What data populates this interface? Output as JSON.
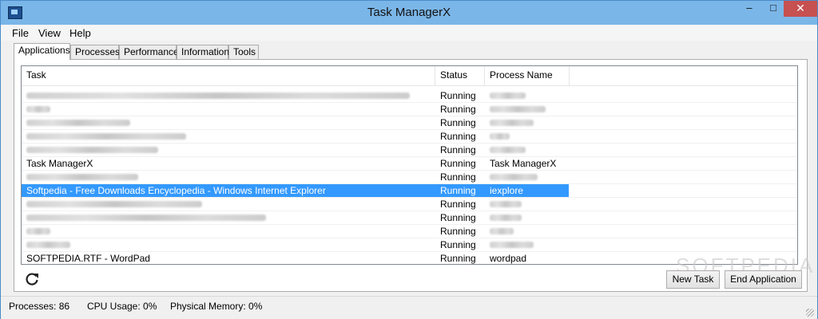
{
  "window": {
    "title": "Task ManagerX",
    "minimize": "–",
    "maximize": "□",
    "close": "✕"
  },
  "menu": [
    "File",
    "View",
    "Help"
  ],
  "tabs": [
    "Applications",
    "Processes",
    "Performance",
    "Information",
    "Tools"
  ],
  "active_tab": "Applications",
  "table": {
    "columns": [
      "Task",
      "Status",
      "Process Name"
    ],
    "rows": [
      {
        "task": "",
        "status": "Running",
        "process": "",
        "task_blur": 480,
        "proc_blur": 45
      },
      {
        "task": "",
        "status": "Running",
        "process": "",
        "task_blur": 30,
        "proc_blur": 70
      },
      {
        "task": "",
        "status": "Running",
        "process": "",
        "task_blur": 130,
        "proc_blur": 55
      },
      {
        "task": "",
        "status": "Running",
        "process": "",
        "task_blur": 200,
        "proc_blur": 25
      },
      {
        "task": "",
        "status": "Running",
        "process": "",
        "task_blur": 165,
        "proc_blur": 45
      },
      {
        "task": "Task ManagerX",
        "status": "Running",
        "process": "Task ManagerX"
      },
      {
        "task": "",
        "status": "Running",
        "process": "",
        "task_blur": 140,
        "proc_blur": 60
      },
      {
        "task": "Softpedia - Free Downloads Encyclopedia - Windows Internet Explorer",
        "status": "Running",
        "process": "iexplore",
        "selected": true
      },
      {
        "task": "",
        "status": "Running",
        "process": "",
        "task_blur": 220,
        "proc_blur": 40
      },
      {
        "task": "",
        "status": "Running",
        "process": "",
        "task_blur": 300,
        "proc_blur": 40
      },
      {
        "task": "",
        "status": "Running",
        "process": "",
        "task_blur": 30,
        "proc_blur": 30
      },
      {
        "task": "",
        "status": "Running",
        "process": "",
        "task_blur": 55,
        "proc_blur": 55
      },
      {
        "task": "SOFTPEDIA.RTF - WordPad",
        "status": "Running",
        "process": "wordpad"
      }
    ]
  },
  "buttons": {
    "refresh_icon": "refresh-icon",
    "new_task": "New Task",
    "end_application": "End Application"
  },
  "watermark": "SOFTPEDIA",
  "status": {
    "processes": "Processes: 86",
    "cpu": "CPU Usage: 0%",
    "memory": "Physical Memory: 0%"
  }
}
